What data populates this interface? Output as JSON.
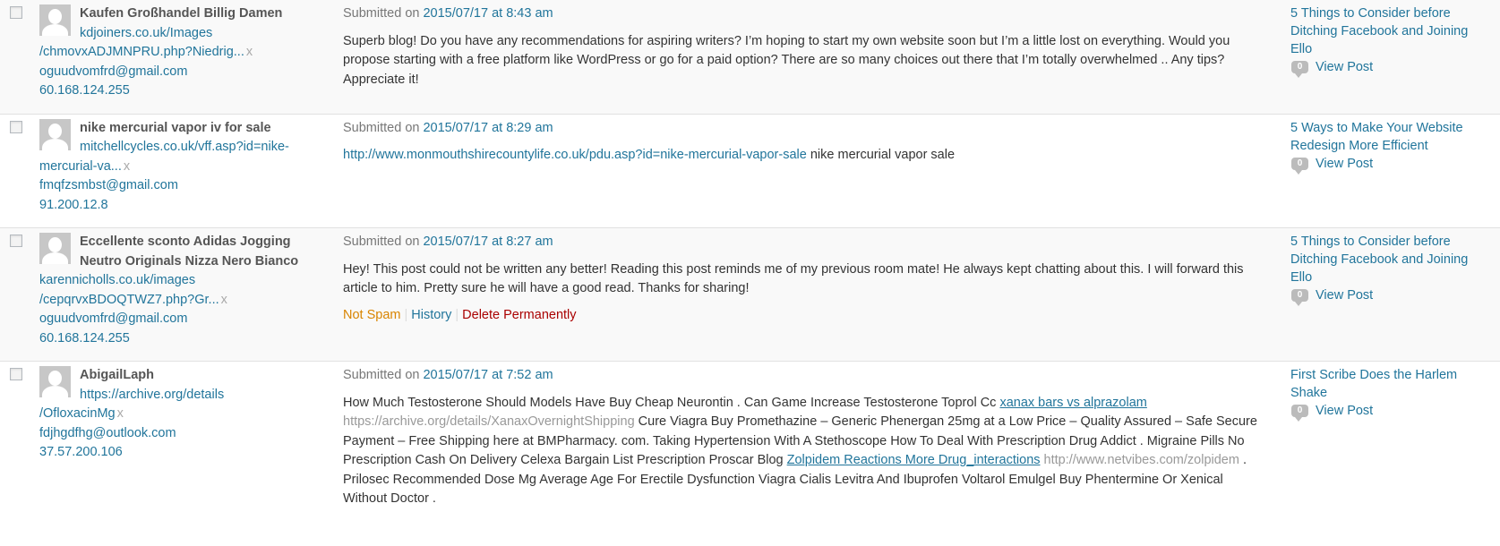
{
  "comments": [
    {
      "author_name": "Kaufen Großhandel Billig Damen",
      "author_url_line1": "kdjoiners.co.uk/Images",
      "author_url_line2": "/chmovxADJMNPRU.php?Niedrig...",
      "remove_label": "x",
      "email": "oguudvomfrd@gmail.com",
      "ip": "60.168.124.255",
      "submitted_prefix": "Submitted on",
      "submitted_date": "2015/07/17 at 8:43 am",
      "text": "Superb blog! Do you have any recommendations for aspiring writers? I’m hoping to start my own website soon but I’m a little lost on everything. Would you propose starting with a free platform like WordPress or go for a paid option? There are so many choices out there that I’m totally overwhelmed .. Any tips? Appreciate it!",
      "post_title": "5 Things to Consider before Ditching Facebook and Joining Ello",
      "comment_count": "0",
      "view_post_label": "View Post"
    },
    {
      "author_name": "nike mercurial vapor iv for sale",
      "author_url_line1": "mitchellcycles.co.uk/vff.asp?id=nike-",
      "author_url_line2": "mercurial-va...",
      "remove_label": "x",
      "email": "fmqfzsmbst@gmail.com",
      "ip": "91.200.12.8",
      "submitted_prefix": "Submitted on",
      "submitted_date": "2015/07/17 at 8:29 am",
      "text_link": "http://www.monmouthshirecountylife.co.uk/pdu.asp?id=nike-mercurial-vapor-sale",
      "text_after": " nike mercurial vapor sale",
      "post_title": "5 Ways to Make Your Website Redesign More Efficient",
      "comment_count": "0",
      "view_post_label": "View Post"
    },
    {
      "author_name": "Eccellente sconto Adidas Jogging Neutro Originals Nizza Nero Bianco",
      "author_url_line1": "karennicholls.co.uk/images",
      "author_url_line2": "/cepqrvxBDOQTWZ7.php?Gr...",
      "remove_label": "x",
      "email": "oguudvomfrd@gmail.com",
      "ip": "60.168.124.255",
      "submitted_prefix": "Submitted on",
      "submitted_date": "2015/07/17 at 8:27 am",
      "text": "Hey! This post could not be written any better! Reading this post reminds me of my previous room mate! He always kept chatting about this. I will forward this article to him. Pretty sure he will have a good read. Thanks for sharing!",
      "actions": {
        "not_spam": "Not Spam",
        "history": "History",
        "delete": "Delete Permanently",
        "separator": "|"
      },
      "post_title": "5 Things to Consider before Ditching Facebook and Joining Ello",
      "comment_count": "0",
      "view_post_label": "View Post"
    },
    {
      "author_name": "AbigailLaph",
      "author_url_line1": "https://archive.org/details",
      "author_url_line2": "/OfloxacinMg",
      "remove_label": "x",
      "email": "fdjhgdfhg@outlook.com",
      "ip": "37.57.200.106",
      "submitted_prefix": "Submitted on",
      "submitted_date": "2015/07/17 at 7:52 am",
      "text_part1": "How Much Testosterone Should Models Have Buy Cheap Neurontin . Can Game Increase Testosterone Toprol Cc ",
      "link1": "xanax bars vs alprazolam",
      "grey_link1": "https://archive.org/details/XanaxOvernightShipping",
      "text_part2": " Cure Viagra Buy Promethazine – Generic Phenergan 25mg at a Low Price – Quality Assured – Safe Secure Payment – Free Shipping here at BMPharmacy. com. Taking Hypertension With A Stethoscope How To Deal With Prescription Drug Addict . Migraine Pills No Prescription Cash On Delivery Celexa Bargain List Prescription Proscar Blog ",
      "link2": "Zolpidem Reactions More Drug_interactions",
      "grey_link2": "http://www.netvibes.com/zolpidem",
      "text_part3": " . Prilosec Recommended Dose Mg Average Age For Erectile Dysfunction Viagra Cialis Levitra And Ibuprofen Voltarol Emulgel Buy Phentermine Or Xenical Without Doctor .",
      "post_title": "First Scribe Does the Harlem Shake",
      "comment_count": "0",
      "view_post_label": "View Post"
    }
  ]
}
